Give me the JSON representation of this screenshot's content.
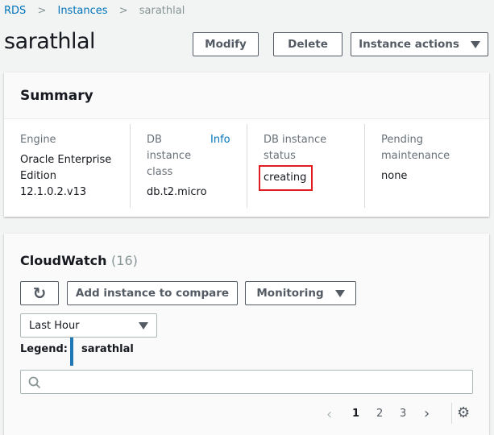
{
  "breadcrumb": [
    "RDS",
    "Instances",
    "sarathlal"
  ],
  "title": "sarathlal",
  "actions": {
    "modify": "Modify",
    "delete": "Delete",
    "instance_actions": "Instance actions"
  },
  "summary": {
    "title": "Summary",
    "engine": {
      "label": "Engine",
      "value_lines": [
        "Oracle Enterprise",
        "Edition",
        "12.1.0.2.v13"
      ]
    },
    "db_class": {
      "label_lines": [
        "DB",
        "instance",
        "class"
      ],
      "info": "Info",
      "value": "db.t2.micro"
    },
    "status": {
      "label_lines": [
        "DB instance",
        "status"
      ],
      "value": "creating"
    },
    "maintenance": {
      "label_lines": [
        "Pending",
        "maintenance"
      ],
      "value": "none"
    }
  },
  "cloudwatch": {
    "title": "CloudWatch",
    "count": "(16)",
    "add_compare": "Add instance to compare",
    "monitoring": "Monitoring",
    "range": "Last Hour",
    "legend_label": "Legend:",
    "legend_item": "sarathlal",
    "legend_color": "#1f78b4",
    "search_placeholder": "",
    "pages": [
      "1",
      "2",
      "3"
    ],
    "current_page": "1"
  }
}
